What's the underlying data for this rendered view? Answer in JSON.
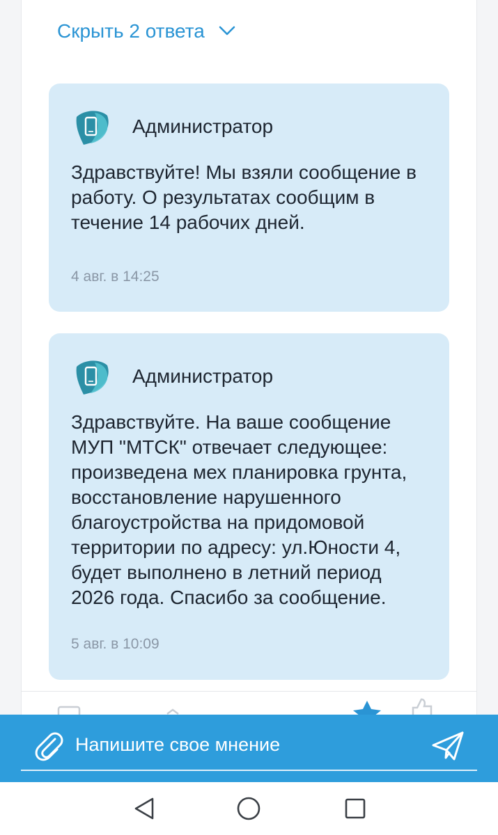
{
  "thread": {
    "hide_replies_label": "Скрыть 2 ответа"
  },
  "replies": [
    {
      "author": "Администратор",
      "text": "Здравствуйте! Мы взяли сообщение в работу. О результатах сообщим в течение 14 рабочих дней.",
      "timestamp": "4 авг. в 14:25"
    },
    {
      "author": "Администратор",
      "text": "Здравствуйте. На ваше сообщение МУП \"МТСК\" отвечает следующее: произведена мех планировка грунта, восстановление нарушенного благоустройства на придомовой территории по адресу: ул.Юности 4, будет выполнено в летний период 2026 года. Спасибо за сообщение.",
      "timestamp": "5 авг. в 10:09"
    }
  ],
  "composer": {
    "placeholder": "Напишите свое мнение"
  },
  "icons": {
    "hide_replies": "chevron-down-icon",
    "avatar": "admin-avatar-icon",
    "attach": "paperclip-icon",
    "send": "send-icon",
    "nav_back": "triangle-back-icon",
    "nav_home": "circle-home-icon",
    "nav_recents": "square-recents-icon"
  },
  "colors": {
    "accent": "#2a94d4",
    "composer_bg": "#2e9ddc",
    "reply_bg": "#d7ebf8",
    "timestamp": "#8a97a6"
  }
}
